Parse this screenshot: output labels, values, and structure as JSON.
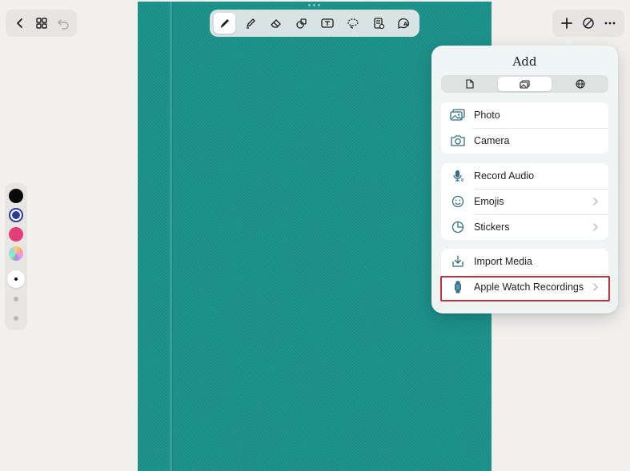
{
  "nav_left": {
    "back_icon": "chevron-left-icon",
    "grid_icon": "grid-icon",
    "undo_icon": "undo-icon"
  },
  "toolbar": {
    "tools": [
      "pen-icon",
      "highlighter-icon",
      "eraser-icon",
      "shapes-icon",
      "text-box-icon",
      "lasso-icon",
      "sticker-icon",
      "ai-assist-icon"
    ],
    "active_tool": "pen-icon"
  },
  "nav_right": {
    "add_icon": "plus-icon",
    "disable_icon": "slash-circle-icon",
    "more_icon": "ellipsis-icon"
  },
  "palette": {
    "colors": [
      "#0a0a0a",
      "#2b3b9c",
      "#e33d7a",
      "rainbow"
    ],
    "selected_color": "#2b3b9c"
  },
  "popover": {
    "title": "Add",
    "segments": [
      "document-icon",
      "image-icon",
      "globe-icon"
    ],
    "selected_segment": "image-icon",
    "groups": [
      [
        {
          "label": "Photo",
          "icon": "photo-icon",
          "chevron": false
        },
        {
          "label": "Camera",
          "icon": "camera-icon",
          "chevron": false
        }
      ],
      [
        {
          "label": "Record Audio",
          "icon": "microphone-icon",
          "chevron": false
        },
        {
          "label": "Emojis",
          "icon": "smiley-icon",
          "chevron": true
        },
        {
          "label": "Stickers",
          "icon": "sticker-icon",
          "chevron": true
        }
      ],
      [
        {
          "label": "Import Media",
          "icon": "import-icon",
          "chevron": false
        },
        {
          "label": "Apple Watch Recordings",
          "icon": "watch-icon",
          "chevron": true
        }
      ]
    ]
  },
  "colors": {
    "accent": "#2f6f88",
    "notebook": "#1b918a",
    "highlight_border": "#b8323f"
  }
}
